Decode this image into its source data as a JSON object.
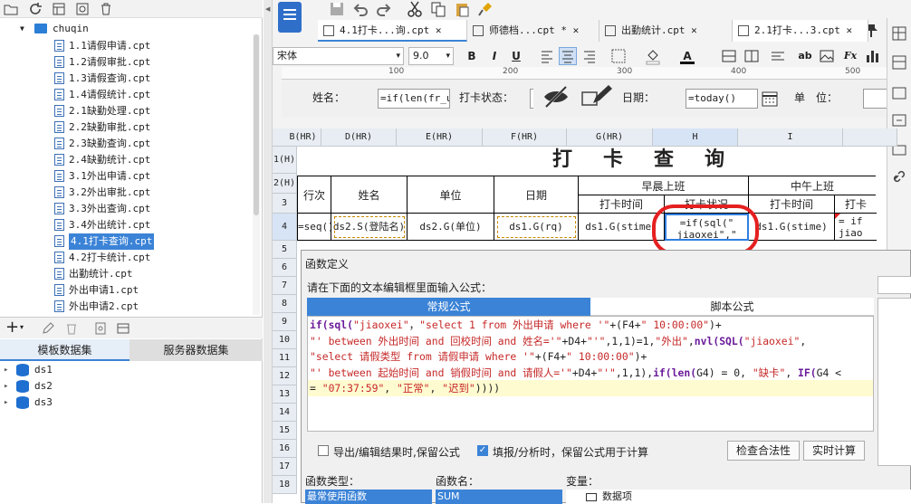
{
  "tree": {
    "root": "chuqin",
    "items": [
      "1.1请假申请.cpt",
      "1.2请假审批.cpt",
      "1.3请假查询.cpt",
      "1.4请假统计.cpt",
      "2.1缺勤处理.cpt",
      "2.2缺勤审批.cpt",
      "2.3缺勤查询.cpt",
      "2.4缺勤统计.cpt",
      "3.1外出申请.cpt",
      "3.2外出审批.cpt",
      "3.3外出查询.cpt",
      "3.4外出统计.cpt",
      "4.1打卡查询.cpt",
      "4.2打卡统计.cpt",
      "出勤统计.cpt",
      "外出申请1.cpt",
      "外出申请2.cpt"
    ],
    "selected_index": 12
  },
  "datasets": {
    "tabs": [
      "模板数据集",
      "服务器数据集"
    ],
    "items": [
      "ds1",
      "ds2",
      "ds3"
    ]
  },
  "tabs": [
    {
      "label": "4.1打卡...询.cpt",
      "close": "✕"
    },
    {
      "label": "师德档...cpt *",
      "close": "✕"
    },
    {
      "label": "出勤统计.cpt",
      "close": "✕"
    },
    {
      "label": "2.1打卡...3.cpt",
      "close": "✕"
    }
  ],
  "format": {
    "font": "宋体",
    "size": "9.0"
  },
  "ruler": [
    "100",
    "200",
    "300",
    "400",
    "500"
  ],
  "params": {
    "name_label": "姓名：",
    "name_value": "=if(len(fr_us",
    "status_label": "打卡状态：",
    "date_label": "日期：",
    "date_value": "=today()",
    "unit_label": "单　位："
  },
  "columns": [
    "B(HR)",
    "D(HR)",
    "E(HR)",
    "F(HR)",
    "G(HR)",
    "H",
    "I"
  ],
  "rows": [
    "1(H)",
    "2(H)",
    "3",
    "4",
    "5",
    "6",
    "7",
    "8",
    "9",
    "10",
    "11",
    "12",
    "13",
    "14",
    "15",
    "16",
    "17",
    "18"
  ],
  "sheet": {
    "title": "打　卡　查　询",
    "h_seq": "行次",
    "h_name": "姓名",
    "h_unit": "单位",
    "h_date": "日期",
    "h_morning": "早晨上班",
    "h_noon": "中午上班",
    "h_time": "打卡时间",
    "h_status": "打卡状况",
    "h_time2": "打卡时间",
    "h_status2": "打卡",
    "r_seq": "=seq()",
    "r_name": "ds2.S(登陆名)",
    "r_unit": "ds2.G(单位)",
    "r_date": "ds1.G(rq)",
    "r_time": "ds1.G(stime)",
    "r_status1": "=if(sql(\"",
    "r_status2": "jiaoxei\",\"",
    "r_time2": "ds1.G(stime)",
    "r_status3": "= if",
    "r_status4": "jiao"
  },
  "dialog": {
    "title": "函数定义",
    "prompt": "请在下面的文本编辑框里面输入公式：",
    "tab_normal": "常规公式",
    "tab_script": "脚本公式",
    "code": [
      [
        [
          "fn",
          "if("
        ],
        [
          "fn",
          "sql("
        ],
        [
          "st",
          "\"jiaoxei\""
        ],
        [
          "",
          "，"
        ],
        [
          "st",
          "\"select 1 from 外出申请 where '\""
        ],
        [
          "",
          "+(F4+"
        ],
        [
          "st",
          "\" 10:00:00\""
        ],
        [
          "",
          ")+"
        ]
      ],
      [
        [
          "st",
          "\"' between 外出时间 and 回校时间 and 姓名='\""
        ],
        [
          "",
          "+D4+"
        ],
        [
          "st",
          "\"'\""
        ],
        [
          "",
          ",1,1)=1,"
        ],
        [
          "st",
          "\"外出\""
        ],
        [
          "",
          ","
        ],
        [
          "fn",
          "nvl("
        ],
        [
          "fn",
          "SQL("
        ],
        [
          "st",
          "\"jiaoxei\""
        ],
        [
          "",
          ","
        ]
      ],
      [
        [
          "st",
          "\"select 请假类型 from 请假申请 where '\""
        ],
        [
          "",
          "+(F4+"
        ],
        [
          "st",
          "\" 10:00:00\""
        ],
        [
          "",
          ")+"
        ]
      ],
      [
        [
          "st",
          "\"' between 起始时间 and 销假时间 and 请假人='\""
        ],
        [
          "",
          "+D4+"
        ],
        [
          "st",
          "\"'\""
        ],
        [
          "",
          ",1,1),"
        ],
        [
          "fn",
          "if("
        ],
        [
          "fn",
          "len("
        ],
        [
          "",
          "G4) = 0, "
        ],
        [
          "st",
          "\"缺卡\""
        ],
        [
          "",
          ", "
        ],
        [
          "fn",
          "IF("
        ],
        [
          "",
          "G4 <"
        ]
      ],
      [
        [
          "",
          "= "
        ],
        [
          "st",
          "\"07:37:59\""
        ],
        [
          "",
          ", "
        ],
        [
          "st",
          "\"正常\""
        ],
        [
          "",
          ", "
        ],
        [
          "st",
          "\"迟到\""
        ],
        [
          "",
          "))))"
        ]
      ]
    ],
    "chk1": "导出/编辑结果时,保留公式",
    "chk2": "填报/分析时，保留公式用于计算",
    "btn_check": "检查合法性",
    "btn_calc": "实时计算",
    "func_type_label": "函数类型：",
    "func_name_label": "函数名：",
    "var_label": "变量：",
    "func_type_value": "最常使用函数",
    "func_name_value": "SUM",
    "var_value": "数据项"
  },
  "colors": {
    "selected": "#3b83d7",
    "accent_red": "#e52020",
    "highlight": "#fffbd0",
    "active_tab": "#3b83d7"
  }
}
